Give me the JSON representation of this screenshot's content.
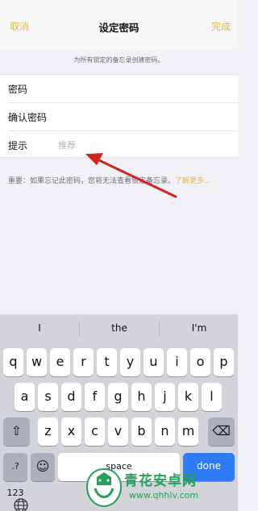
{
  "nav": {
    "cancel": "取消",
    "title": "设定密码",
    "done": "完成"
  },
  "subhead": "为所有锁定的备忘录创建密码。",
  "fields": [
    {
      "label": "密码",
      "placeholder": ""
    },
    {
      "label": "确认密码",
      "placeholder": ""
    },
    {
      "label": "提示",
      "placeholder": "推荐"
    }
  ],
  "note": {
    "text": "重要：如果忘记此密码，您将无法查看锁定备忘录。",
    "link": "了解更多..."
  },
  "predictions": [
    "I",
    "the",
    "I'm"
  ],
  "keyboard": {
    "row1": [
      "q",
      "w",
      "e",
      "r",
      "t",
      "y",
      "u",
      "i",
      "o",
      "p"
    ],
    "row2": [
      "a",
      "s",
      "d",
      "f",
      "g",
      "h",
      "j",
      "k",
      "l"
    ],
    "row3": [
      "z",
      "x",
      "c",
      "v",
      "b",
      "n",
      "m"
    ],
    "shift": "⇧",
    "delete": "⌫",
    "numbers": ".?123",
    "emoji": "☺",
    "space": "space",
    "done": "done"
  },
  "watermark": {
    "brand": "青花安卓网",
    "url": "www.qhhlv.com"
  },
  "colors": {
    "accent": "#e7b640",
    "arrow": "#d0241f",
    "done_key": "#2f7bf5",
    "watermark": "#23a05a"
  }
}
